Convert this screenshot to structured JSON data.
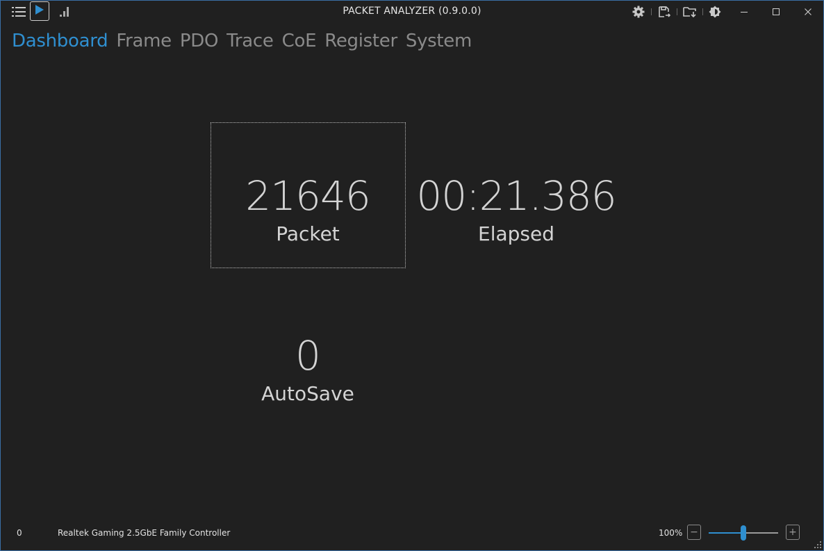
{
  "window": {
    "title": "PACKET ANALYZER (0.9.0.0)"
  },
  "icons": {
    "menu": "list-menu-icon",
    "play": "play-icon",
    "stats": "signal-bars-icon",
    "settings": "gear-icon",
    "save": "save-export-icon",
    "folder": "folder-download-icon",
    "theme": "brightness-icon",
    "minimize": "minimize-icon",
    "maximize": "maximize-icon",
    "close": "close-icon"
  },
  "tabs": [
    {
      "label": "Dashboard",
      "active": true
    },
    {
      "label": "Frame",
      "active": false
    },
    {
      "label": "PDO",
      "active": false
    },
    {
      "label": "Trace",
      "active": false
    },
    {
      "label": "CoE",
      "active": false
    },
    {
      "label": "Register",
      "active": false
    },
    {
      "label": "System",
      "active": false
    }
  ],
  "stats": {
    "packet": {
      "value": "21646",
      "label": "Packet"
    },
    "elapsed": {
      "value": "00:21.386",
      "label": "Elapsed"
    },
    "autosave": {
      "value": "0",
      "label": "AutoSave"
    }
  },
  "status": {
    "count": "0",
    "adapter": "Realtek Gaming 2.5GbE Family Controller",
    "zoom_label": "100%",
    "zoom_minus": "−",
    "zoom_plus": "+",
    "zoom_level": 0.5
  },
  "colors": {
    "accent": "#2f8fd0",
    "background": "#202020",
    "text": "#d4d4d4",
    "inactive_tab": "#8a8a8a"
  }
}
